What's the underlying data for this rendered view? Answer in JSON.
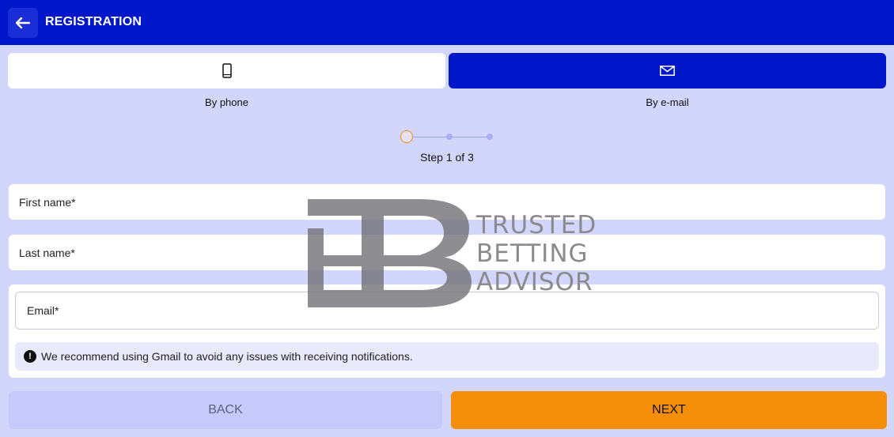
{
  "header": {
    "title": "REGISTRATION",
    "back_icon": "arrow-left-icon"
  },
  "methods": [
    {
      "label": "By phone",
      "icon": "phone-icon",
      "selected": false
    },
    {
      "label": "By e-mail",
      "icon": "envelope-icon",
      "selected": true
    }
  ],
  "stepper": {
    "current": 1,
    "total": 3,
    "text": "Step 1 of 3"
  },
  "fields": {
    "first_name": {
      "placeholder": "First name*",
      "value": ""
    },
    "last_name": {
      "placeholder": "Last name*",
      "value": ""
    },
    "email": {
      "placeholder": "Email*",
      "value": ""
    }
  },
  "notice": {
    "icon": "exclamation-circle-icon",
    "text": "We recommend using Gmail to avoid any issues with receiving notifications."
  },
  "buttons": {
    "back_label": "BACK",
    "next_label": "NEXT"
  },
  "watermark": {
    "line1": "TRUSTED",
    "line2": "BETTING",
    "line3": "ADVISOR"
  },
  "colors": {
    "primary": "#0217c9",
    "background": "#d3d6fb",
    "accent": "#f58f0a"
  }
}
